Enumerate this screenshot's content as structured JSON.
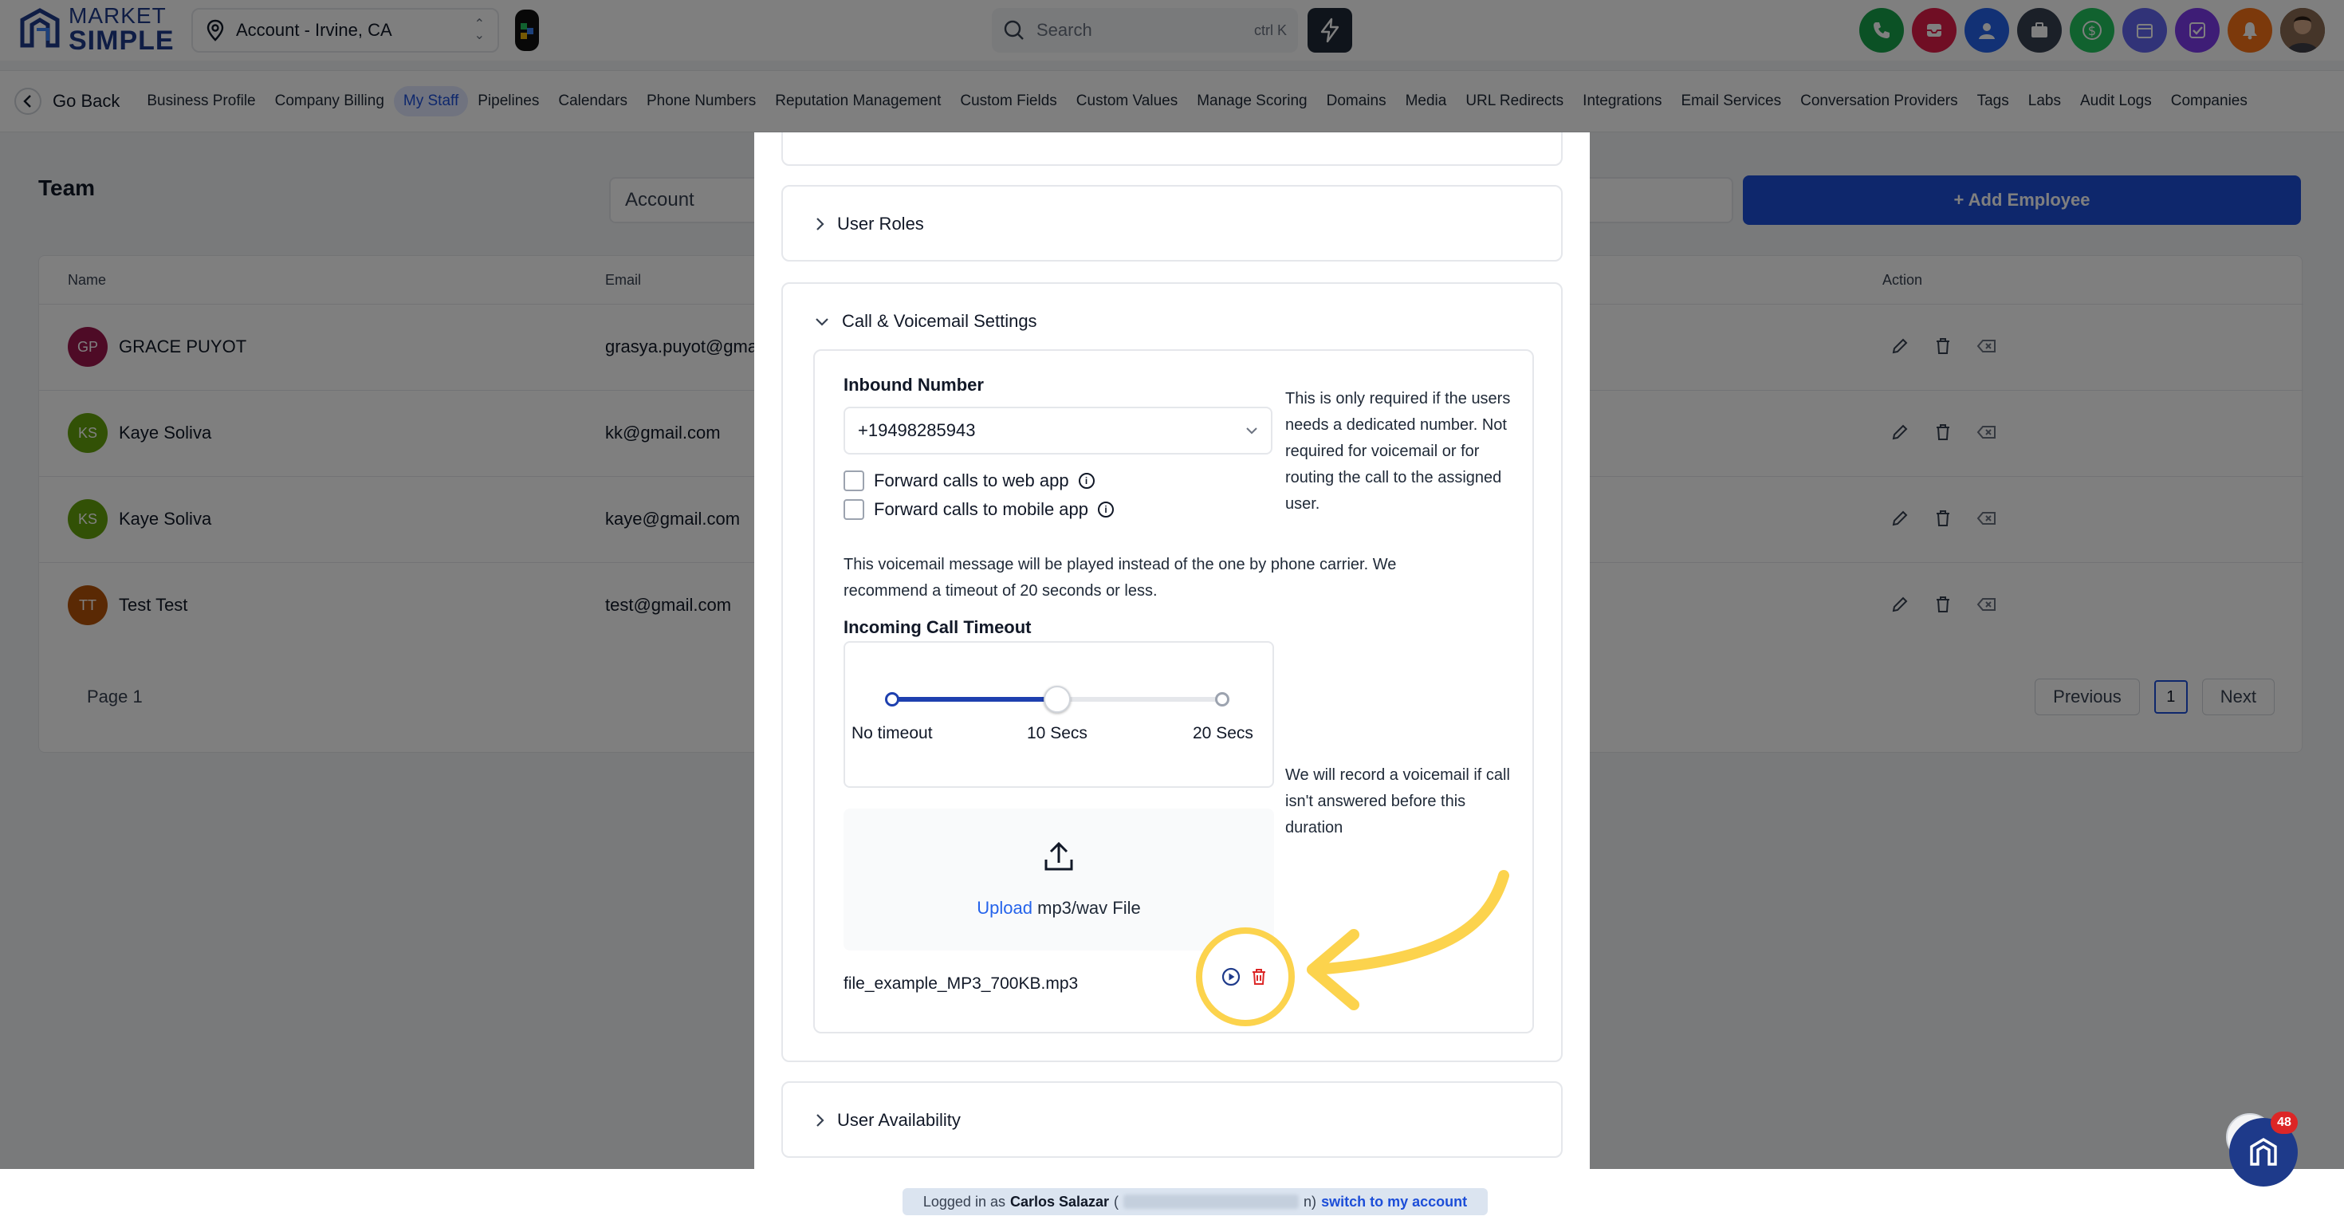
{
  "topbar": {
    "logo_line1": "MARKET",
    "logo_line2": "SIMPLE",
    "account_name": "Account - Irvine, CA",
    "search_placeholder": "Search",
    "search_shortcut": "ctrl K",
    "icons": [
      "phone-icon",
      "inbox-icon",
      "user-icon",
      "briefcase-icon",
      "dollar-icon",
      "calendar-icon",
      "task-icon",
      "bell-icon",
      "profile-avatar"
    ],
    "icon_colors": [
      "#16a34a",
      "#e11d48",
      "#2563eb",
      "#374151",
      "#22c55e",
      "#6366f1",
      "#7c3aed",
      "#f97316",
      "#6b4f3a"
    ]
  },
  "subnav": {
    "go_back": "Go Back",
    "links": [
      "Business Profile",
      "Company Billing",
      "My Staff",
      "Pipelines",
      "Calendars",
      "Phone Numbers",
      "Reputation Management",
      "Custom Fields",
      "Custom Values",
      "Manage Scoring",
      "Domains",
      "Media",
      "URL Redirects",
      "Integrations",
      "Email Services",
      "Conversation Providers",
      "Tags",
      "Labs",
      "Audit Logs",
      "Companies"
    ],
    "active": "My Staff"
  },
  "team": {
    "title": "Team",
    "search_value": "Account",
    "add_button": "+ Add Employee",
    "columns": [
      "Name",
      "Email",
      "Action"
    ],
    "rows": [
      {
        "initials": "GP",
        "name": "GRACE PUYOT",
        "email": "grasya.puyot@gma",
        "color": "#9d174d"
      },
      {
        "initials": "KS",
        "name": "Kaye Soliva",
        "email": "kk@gmail.com",
        "color": "#65a30d"
      },
      {
        "initials": "KS",
        "name": "Kaye Soliva",
        "email": "kaye@gmail.com",
        "color": "#65a30d"
      },
      {
        "initials": "TT",
        "name": "Test Test",
        "email": "test@gmail.com",
        "color": "#b45309"
      }
    ],
    "page_text": "Page 1",
    "prev": "Previous",
    "page_num": "1",
    "next": "Next"
  },
  "modal": {
    "user_roles": "User Roles",
    "call_settings": "Call & Voicemail Settings",
    "inbound_label": "Inbound Number",
    "inbound_value": "+19498285943",
    "inbound_note": "This is only required if the users needs a dedicated number. Not required for voicemail or for routing the call to the assigned user.",
    "forward_web": "Forward calls to web app",
    "forward_mobile": "Forward calls to mobile app",
    "voicemail_note": "This voicemail message will be played instead of the one by phone carrier. We recommend a timeout of 20 seconds or less.",
    "timeout_label": "Incoming Call Timeout",
    "tick_labels": [
      "No timeout",
      "10 Secs",
      "20 Secs"
    ],
    "timeout_fraction": 0.5,
    "timeout_note": "We will record a voicemail if call isn't answered before this duration",
    "upload_link": "Upload",
    "upload_text": " mp3/wav File",
    "file_name": "file_example_MP3_700KB.mp3",
    "user_availability": "User Availability"
  },
  "footer": {
    "logged_prefix": "Logged in as",
    "user": "Carlos Salazar",
    "open_paren": "(",
    "close": "n)",
    "switch": "switch to my account"
  },
  "chat": {
    "badge": "48"
  }
}
